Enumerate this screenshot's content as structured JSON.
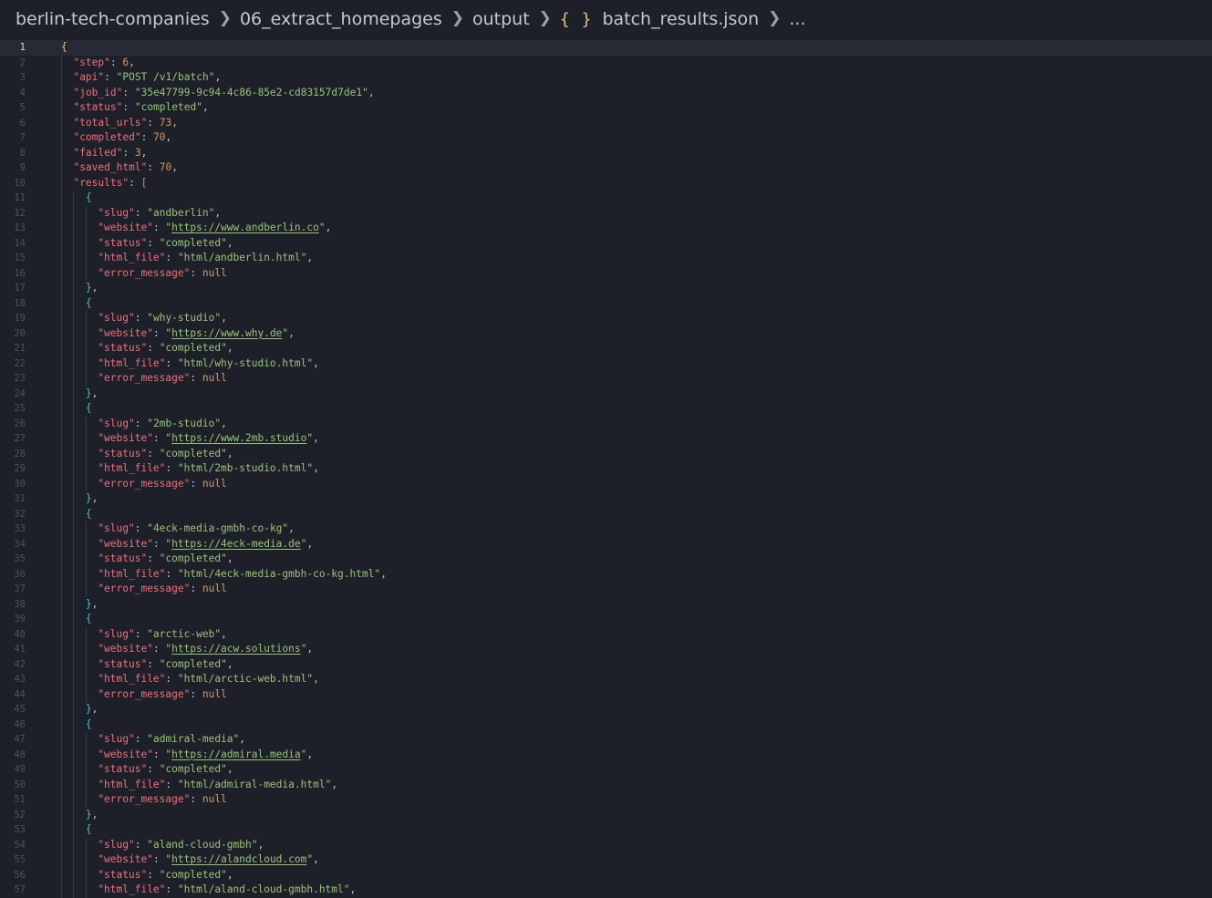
{
  "breadcrumb": {
    "items": [
      "berlin-tech-companies",
      "06_extract_homepages",
      "output",
      "batch_results.json",
      "..."
    ],
    "file_icon": "{ }"
  },
  "editor": {
    "current_line": 1,
    "header": [
      {
        "key": "step",
        "value": "6",
        "type": "number"
      },
      {
        "key": "api",
        "value": "POST /v1/batch",
        "type": "string"
      },
      {
        "key": "job_id",
        "value": "35e47799-9c94-4c86-85e2-cd83157d7de1",
        "type": "string"
      },
      {
        "key": "status",
        "value": "completed",
        "type": "string"
      },
      {
        "key": "total_urls",
        "value": "73",
        "type": "number"
      },
      {
        "key": "completed",
        "value": "70",
        "type": "number"
      },
      {
        "key": "failed",
        "value": "3",
        "type": "number"
      },
      {
        "key": "saved_html",
        "value": "70",
        "type": "number"
      }
    ],
    "results_key": "results",
    "results": [
      {
        "slug": "andberlin",
        "website": "https://www.andberlin.co",
        "status": "completed",
        "html_file": "html/andberlin.html",
        "error_message": "null"
      },
      {
        "slug": "why-studio",
        "website": "https://www.why.de",
        "status": "completed",
        "html_file": "html/why-studio.html",
        "error_message": "null"
      },
      {
        "slug": "2mb-studio",
        "website": "https://www.2mb.studio",
        "status": "completed",
        "html_file": "html/2mb-studio.html",
        "error_message": "null"
      },
      {
        "slug": "4eck-media-gmbh-co-kg",
        "website": "https://4eck-media.de",
        "status": "completed",
        "html_file": "html/4eck-media-gmbh-co-kg.html",
        "error_message": "null"
      },
      {
        "slug": "arctic-web",
        "website": "https://acw.solutions",
        "status": "completed",
        "html_file": "html/arctic-web.html",
        "error_message": "null"
      },
      {
        "slug": "admiral-media",
        "website": "https://admiral.media",
        "status": "completed",
        "html_file": "html/admiral-media.html",
        "error_message": "null"
      },
      {
        "slug": "aland-cloud-gmbh",
        "website": "https://alandcloud.com",
        "status": "completed",
        "html_file": "html/aland-cloud-gmbh.html"
      }
    ]
  },
  "colors": {
    "background": "#1e2029",
    "key": "#ef6f7a",
    "string": "#98c379",
    "number": "#d19a66",
    "bracket_level_0": "#e5c07b",
    "bracket_level_1": "#c678dd",
    "bracket_level_2": "#56b6c2"
  }
}
